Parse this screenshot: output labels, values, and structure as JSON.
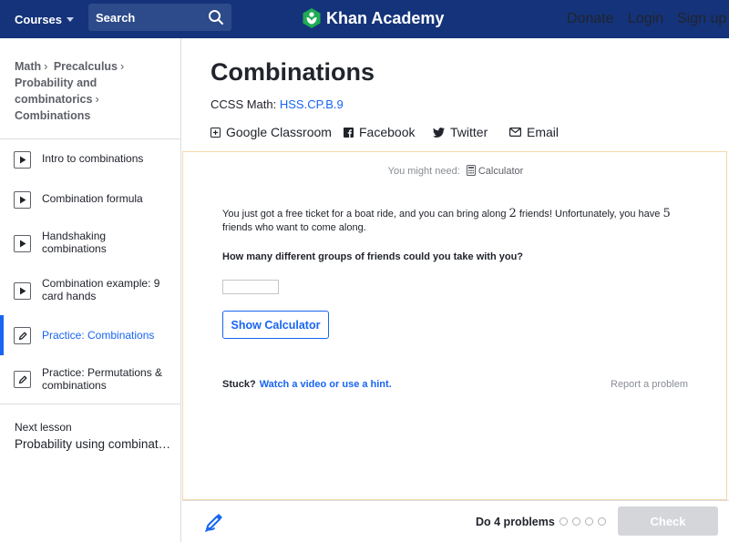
{
  "nav": {
    "courses_label": "Courses",
    "search_placeholder": "Search",
    "logo_text": "Khan Academy",
    "donate_label": "Donate",
    "login_label": "Login",
    "signup_label": "Sign up",
    "colors": {
      "bar": "#14337a",
      "search_bg": "#2d4a8a",
      "logo_leaf": "#1fab54"
    }
  },
  "sidebar": {
    "breadcrumb": [
      "Math",
      "Precalculus",
      "Probability and combinatorics",
      "Combinations"
    ],
    "items": [
      {
        "label": "Intro to combinations",
        "icon": "play-icon",
        "active": false
      },
      {
        "label": "Combination formula",
        "icon": "play-icon",
        "active": false
      },
      {
        "label": "Handshaking combinations",
        "icon": "play-icon",
        "active": false
      },
      {
        "label": "Combination example: 9 card hands",
        "icon": "play-icon",
        "active": false
      },
      {
        "label": "Practice: Combinations",
        "icon": "pencil-icon",
        "active": true
      },
      {
        "label": "Practice: Permutations & combinations",
        "icon": "pencil-icon",
        "active": false
      }
    ],
    "next_lesson_label": "Next lesson",
    "next_lesson_title": "Probability using combinatorics"
  },
  "main": {
    "title": "Combinations",
    "ccss_prefix": "CCSS Math:",
    "ccss_code": "HSS.CP.B.9",
    "share": {
      "classroom": "Google Classroom",
      "facebook": "Facebook",
      "twitter": "Twitter",
      "email": "Email"
    }
  },
  "exercise": {
    "need_prefix": "You might need:",
    "need_tool": "Calculator",
    "question_part1": "You just got a free ticket for a boat ride, and you can bring along",
    "question_num1": "2",
    "question_part2": "friends! Unfortunately, you have",
    "question_num2": "5",
    "question_part3": "friends who want to come along.",
    "ask": "How many different groups of friends could you take with you?",
    "answer_value": "",
    "show_calc_label": "Show Calculator",
    "stuck_label": "Stuck?",
    "hint_link": "Watch a video or use a hint.",
    "report_label": "Report a problem"
  },
  "footer": {
    "do_problems": "Do 4 problems",
    "progress_total": 4,
    "progress_done": 0,
    "check_label": "Check",
    "accent": "#1865f2"
  }
}
